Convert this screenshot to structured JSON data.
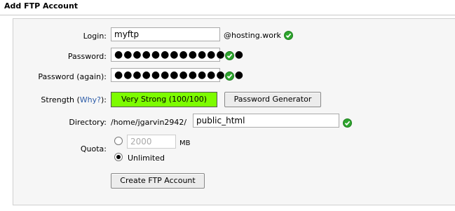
{
  "title": "Add FTP Account",
  "form": {
    "login_label": "Login:",
    "login_value": "myftp",
    "domain_suffix": "@hosting.work",
    "password_label": "Password:",
    "password_value": "●●●●●●●●●●●●●●",
    "password_again_label": "Password (again):",
    "password_again_value": "●●●●●●●●●●●●●●",
    "strength_label": "Strength (",
    "strength_link": "Why?",
    "strength_label_end": "):",
    "strength_value": "Very Strong (100/100)",
    "password_generator": "Password Generator",
    "directory_label": "Directory:",
    "directory_prefix": "/home/jgarvin2942/",
    "directory_value": "public_html",
    "quota_label": "Quota:",
    "quota_value": "2000",
    "quota_unit": "MB",
    "unlimited_label": "Unlimited",
    "submit": "Create FTP Account"
  },
  "colors": {
    "strength_bar": "#7dfc00",
    "check": "#2ea52e",
    "link": "#2d5ca8"
  }
}
